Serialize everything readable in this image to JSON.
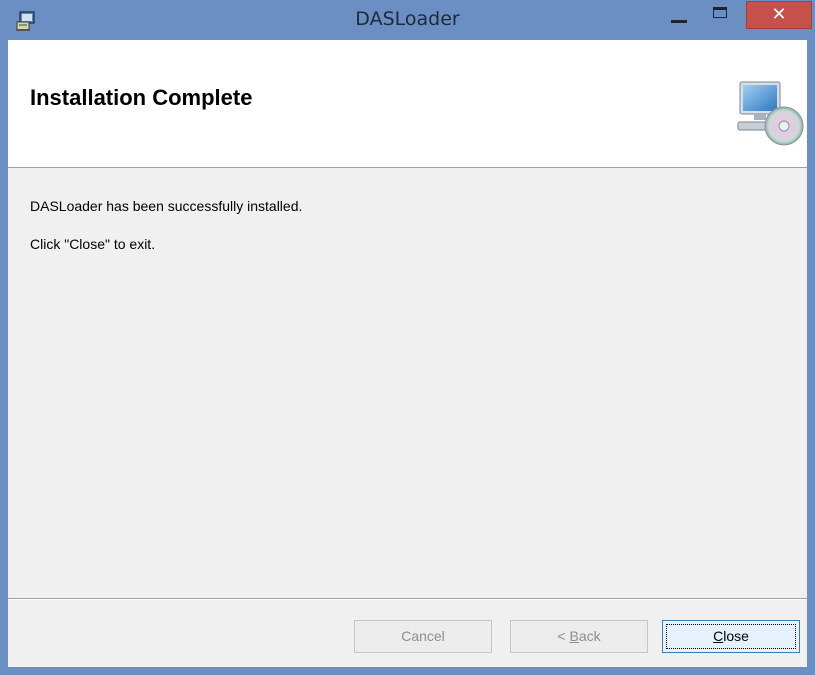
{
  "window": {
    "title": "DASLoader",
    "close_glyph": "✕"
  },
  "banner": {
    "title": "Installation Complete",
    "icon": "computer-cd-icon"
  },
  "body": {
    "line1": "DASLoader has been successfully installed.",
    "line2": "Click \"Close\" to exit."
  },
  "buttons": {
    "cancel": "Cancel",
    "back_prefix": "< ",
    "back_accel": "B",
    "back_rest": "ack",
    "close_accel": "C",
    "close_rest": "lose"
  },
  "colors": {
    "titlebar": "#6b8fc2",
    "close_button": "#c7504a",
    "dialog_bg": "#f0f0f0"
  }
}
